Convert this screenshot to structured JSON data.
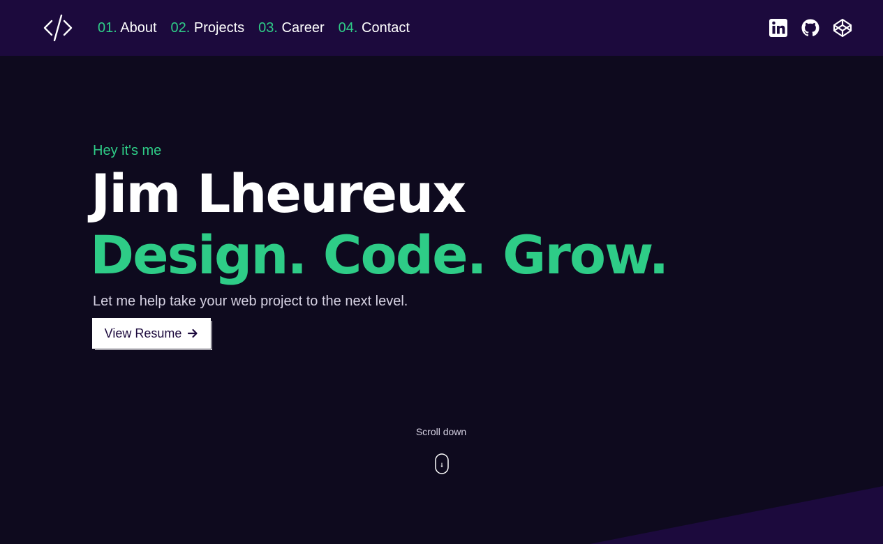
{
  "nav": {
    "logo": "code-brackets-icon",
    "links": [
      {
        "num": "01.",
        "label": "About"
      },
      {
        "num": "02.",
        "label": "Projects"
      },
      {
        "num": "03.",
        "label": "Career"
      },
      {
        "num": "04.",
        "label": "Contact"
      }
    ],
    "social": [
      "linkedin-icon",
      "github-icon",
      "codepen-icon"
    ]
  },
  "hero": {
    "greeting": "Hey it's me",
    "name": "Jim Lheureux",
    "tagline": "Design. Code. Grow.",
    "subtitle": "Let me help take your web project to the next level.",
    "resume_label": "View Resume"
  },
  "scroll": {
    "label": "Scroll down"
  },
  "colors": {
    "background": "#0e0a1e",
    "navbar": "#1c0a3d",
    "accent": "#2ecc87",
    "text": "#ffffff"
  }
}
